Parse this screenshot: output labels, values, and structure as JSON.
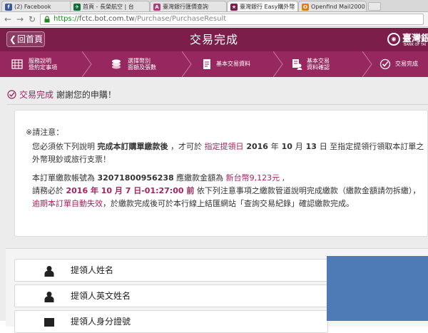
{
  "browser": {
    "tabs": [
      {
        "label": "(2) Facebook",
        "favicon": "f",
        "color": "#3b5998"
      },
      {
        "label": "首頁 - 長榮航空 | 台",
        "favicon": "✈",
        "color": "#0f6b38"
      },
      {
        "label": "臺灣銀行匯價查詢",
        "favicon": "A",
        "color": "#b03a7a"
      },
      {
        "label": "臺灣銀行 Easy購外幣",
        "favicon": "★",
        "color": "#7b1f4a"
      },
      {
        "label": "Openfind Mail2000",
        "favicon": "O",
        "color": "#e07b1a"
      }
    ],
    "url_prefix": "https://",
    "url_host": "fctc.bot.com.tw",
    "url_path": "/Purchase/PurchaseResult"
  },
  "header": {
    "home_label": "回首頁",
    "title": "交易完成",
    "bank_name": "臺灣銀",
    "bank_en": "BANK OF TAI"
  },
  "steps": [
    {
      "line1": "服務說明",
      "line2": "暨約定事項",
      "icon": "grid-icon"
    },
    {
      "line1": "選擇幣別",
      "line2": "面額及張數",
      "icon": "coins-icon"
    },
    {
      "line1": "基本交易資料",
      "line2": "",
      "icon": "document-icon"
    },
    {
      "line1": "基本交易",
      "line2": "資料確認",
      "icon": "person-doc-icon"
    },
    {
      "line1": "交易完成",
      "line2": "",
      "icon": "check-icon"
    }
  ],
  "status": {
    "done": "交易完成",
    "thanks": "謝謝您的申購！"
  },
  "notice": {
    "heading": "※請注意：",
    "p1_a": "您必須依下列說明 ",
    "p1_b": "完成本訂購單繳款後",
    "p1_c": " ，才可於 ",
    "p1_d": "指定提領日",
    "p1_e": " 2016 ",
    "p1_f": "年",
    "p1_g": " 10 ",
    "p1_h": "月",
    "p1_i": " 13 ",
    "p1_j": "日",
    "p1_k": " 至指定提領行領取本訂單之外幣現鈔或旅行支票！",
    "p2_a": "本訂單繳款帳號為 ",
    "p2_account": "32071800956238",
    "p2_b": " 應繳款金額為 ",
    "p2_amount": "新台幣9,123元",
    "p2_c": " ,",
    "p3_a": "請務必於 ",
    "p3_deadline": "2016 年 10 月 7 日-01:27:00 前",
    "p3_b": " 依下列注意事項之繳款管道說明完成繳款（繳款金額請勿拆繳），",
    "p3_c": "逾期本訂單自動失效",
    "p3_d": "，於繳款完成後可於本行線上結匯網站「查詢交易紀錄」確認繳款完成。"
  },
  "form": {
    "fields": [
      {
        "label": "提領人姓名"
      },
      {
        "label": "提領人英文姓名"
      },
      {
        "label": "提領人身分證號"
      }
    ]
  }
}
